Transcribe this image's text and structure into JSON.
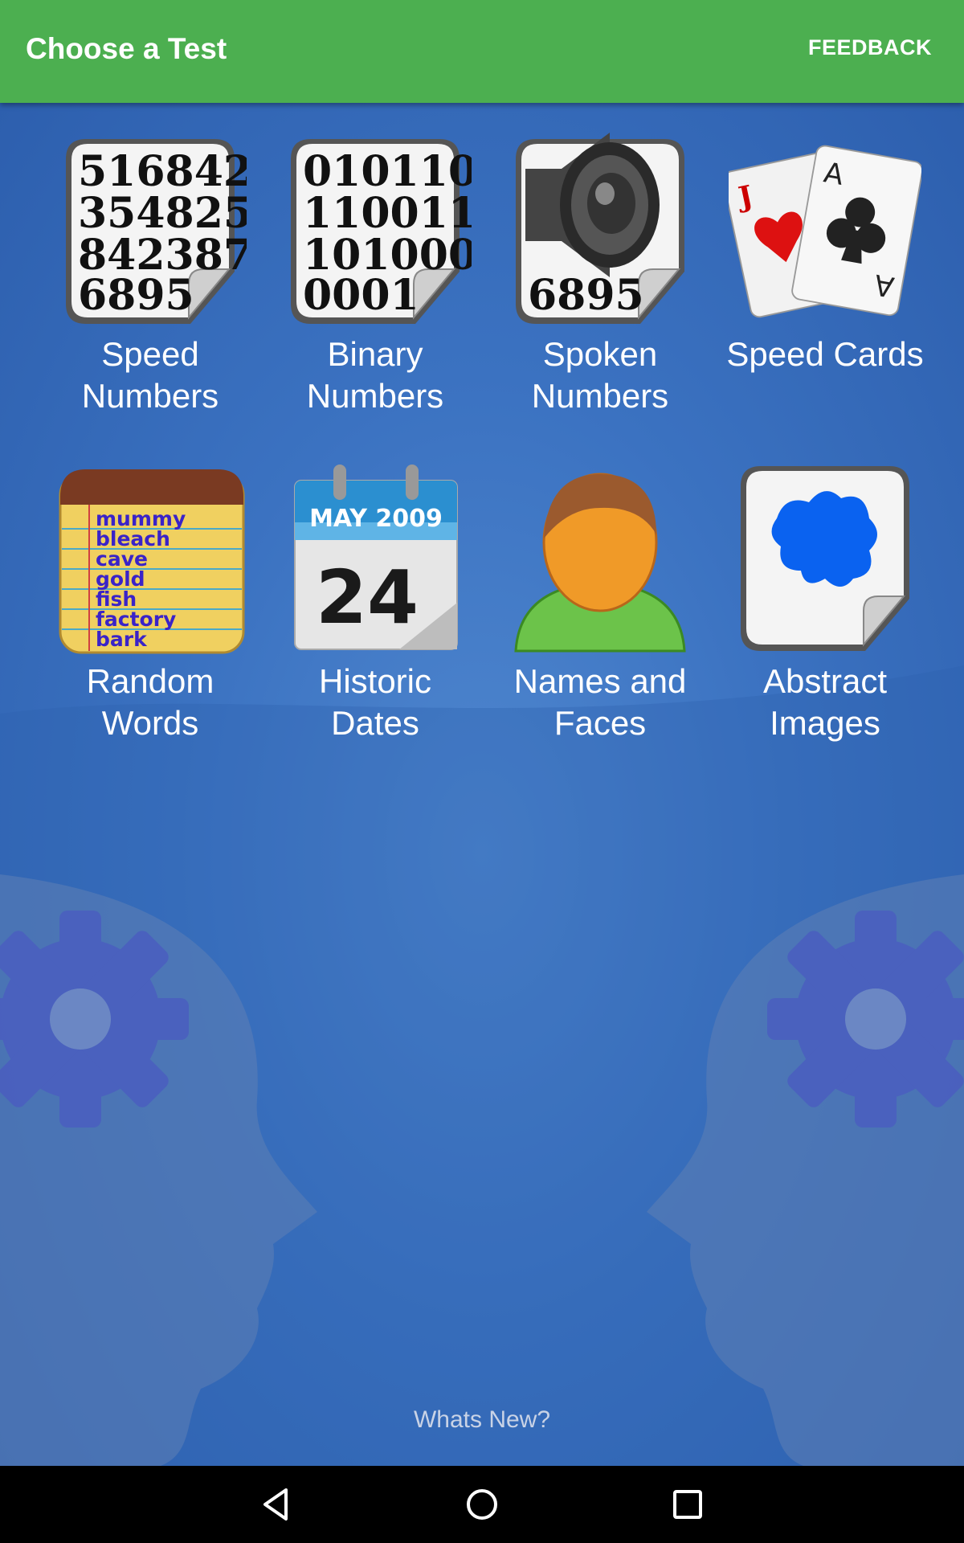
{
  "app_bar": {
    "title": "Choose a Test",
    "feedback_label": "FEEDBACK"
  },
  "tests": [
    {
      "label": "Speed\nNumbers",
      "icon": "speed-numbers-icon",
      "icon_text": [
        "516842",
        "354825",
        "842387",
        "6895"
      ]
    },
    {
      "label": "Binary\nNumbers",
      "icon": "binary-numbers-icon",
      "icon_text": [
        "010110",
        "110011",
        "101000",
        "0001"
      ]
    },
    {
      "label": "Spoken\nNumbers",
      "icon": "speaker-icon",
      "icon_text": [
        "6895"
      ]
    },
    {
      "label": "Speed Cards",
      "icon": "playing-cards-icon",
      "icon_text": [
        "J",
        "A",
        "A"
      ]
    },
    {
      "label": "Random\nWords",
      "icon": "word-list-icon",
      "icon_text": [
        "mummy",
        "bleach",
        "cave",
        "gold",
        "fish",
        "factory",
        "bark"
      ]
    },
    {
      "label": "Historic\nDates",
      "icon": "calendar-icon",
      "icon_text": [
        "MAY 2009",
        "24"
      ]
    },
    {
      "label": "Names and\nFaces",
      "icon": "person-icon",
      "icon_text": []
    },
    {
      "label": "Abstract\nImages",
      "icon": "abstract-blot-icon",
      "icon_text": []
    }
  ],
  "footer": {
    "whats_new": "Whats New?"
  },
  "nav": {
    "back": "back-icon",
    "home": "home-icon",
    "recents": "recents-icon"
  },
  "colors": {
    "app_bar": "#4caf50",
    "background": "#3b72c1",
    "nav_bar": "#000000"
  }
}
